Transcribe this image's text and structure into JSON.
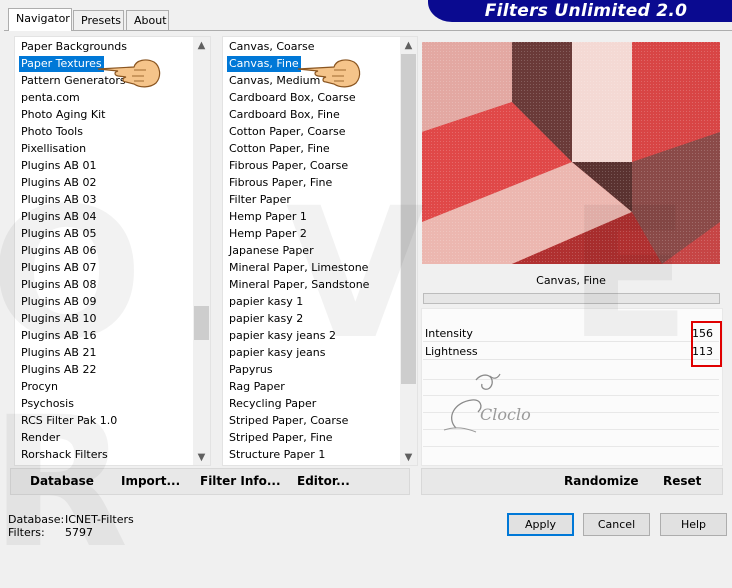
{
  "tabs": [
    "Navigator",
    "Presets",
    "About"
  ],
  "banner_title": "Filters Unlimited 2.0",
  "categories": [
    "Paper Backgrounds",
    "Paper Textures",
    "Pattern Generators",
    "penta.com",
    "Photo Aging Kit",
    "Photo Tools",
    "Pixellisation",
    "Plugins AB 01",
    "Plugins AB 02",
    "Plugins AB 03",
    "Plugins AB 04",
    "Plugins AB 05",
    "Plugins AB 06",
    "Plugins AB 07",
    "Plugins AB 08",
    "Plugins AB 09",
    "Plugins AB 10",
    "Plugins AB 16",
    "Plugins AB 21",
    "Plugins AB 22",
    "Procyn",
    "Psychosis",
    "RCS Filter Pak 1.0",
    "Render",
    "Rorshack Filters"
  ],
  "selected_category": "Paper Textures",
  "filters": [
    "Canvas, Coarse",
    "Canvas, Fine",
    "Canvas, Medium",
    "Cardboard Box, Coarse",
    "Cardboard Box, Fine",
    "Cotton Paper, Coarse",
    "Cotton Paper, Fine",
    "Fibrous Paper, Coarse",
    "Fibrous Paper, Fine",
    "Filter Paper",
    "Hemp Paper 1",
    "Hemp Paper 2",
    "Japanese Paper",
    "Mineral Paper, Limestone",
    "Mineral Paper, Sandstone",
    "papier kasy 1",
    "papier kasy 2",
    "papier kasy jeans 2",
    "papier kasy jeans",
    "Papyrus",
    "Rag Paper",
    "Recycling Paper",
    "Striped Paper, Coarse",
    "Striped Paper, Fine",
    "Structure Paper 1"
  ],
  "selected_filter": "Canvas, Fine",
  "filter_name": "Canvas, Fine",
  "params": [
    {
      "label": "Intensity",
      "value": "156"
    },
    {
      "label": "Lightness",
      "value": "113"
    }
  ],
  "watermark_text": "Cloclo",
  "toolbar": {
    "database": "Database",
    "import": "Import...",
    "filter_info": "Filter Info...",
    "editor": "Editor...",
    "randomize": "Randomize",
    "reset": "Reset"
  },
  "status": {
    "database_label": "Database:",
    "database_value": "ICNET-Filters",
    "filters_label": "Filters:",
    "filters_value": "5797"
  },
  "buttons": {
    "apply": "Apply",
    "cancel": "Cancel",
    "help": "Help"
  },
  "colors": {
    "accent": "#0078d7",
    "banner": "#0a0a90",
    "highlight": "#e00000"
  }
}
